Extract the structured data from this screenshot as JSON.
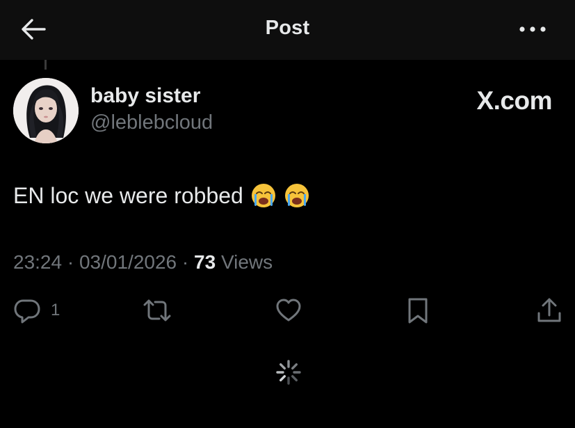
{
  "header": {
    "title": "Post"
  },
  "author": {
    "display_name": "baby sister",
    "handle": "@leblebcloud"
  },
  "watermark": "X.com",
  "tweet": {
    "text": "EN loc we were robbed",
    "emojis": [
      "loudly-crying-face",
      "loudly-crying-face"
    ]
  },
  "meta": {
    "time": "23:24",
    "separator": "·",
    "date": "03/01/2026",
    "views_count": "73",
    "views_label": "Views"
  },
  "actions": {
    "reply_count": "1"
  },
  "colors": {
    "background": "#000000",
    "header_bg": "#0e0e0e",
    "primary_text": "#e7e9ea",
    "secondary_text": "#71767b"
  },
  "icons": [
    "back-arrow-icon",
    "more-icon",
    "reply-icon",
    "retweet-icon",
    "like-icon",
    "bookmark-icon",
    "share-icon",
    "loading-spinner-icon"
  ]
}
